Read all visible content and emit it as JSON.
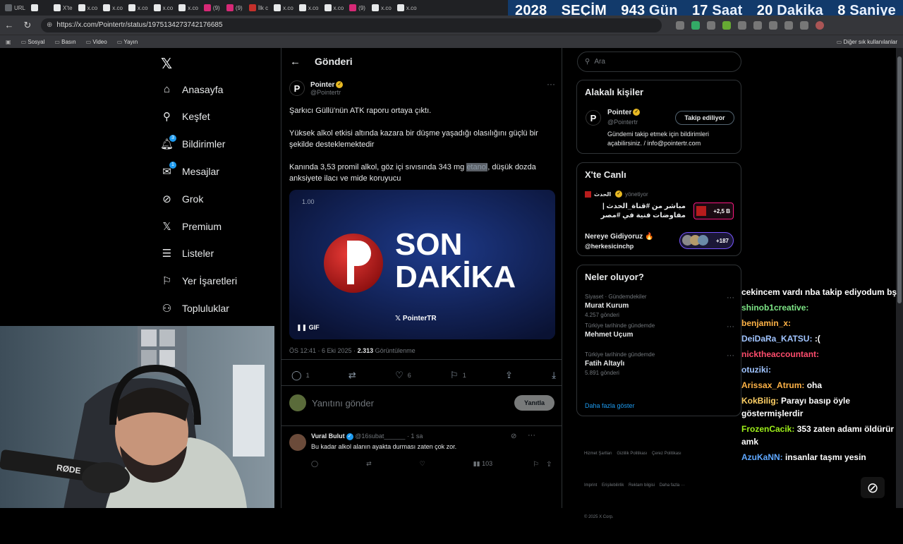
{
  "browser": {
    "tabs": [
      {
        "label": "URL",
        "color": "#5f6368"
      },
      {
        "label": "",
        "color": "#e7e9ea"
      },
      {
        "label": "X'te",
        "color": "#e7e9ea"
      },
      {
        "label": "x.co",
        "color": "#e7e9ea"
      },
      {
        "label": "x.co",
        "color": "#e7e9ea"
      },
      {
        "label": "x.co",
        "color": "#e7e9ea"
      },
      {
        "label": "x.co",
        "color": "#e7e9ea"
      },
      {
        "label": "x.co",
        "color": "#e7e9ea"
      },
      {
        "label": "(9)",
        "color": "#d62976"
      },
      {
        "label": "(9)",
        "color": "#d62976"
      },
      {
        "label": "İlk c",
        "color": "#c4302b"
      },
      {
        "label": "x.co",
        "color": "#e7e9ea"
      },
      {
        "label": "x.co",
        "color": "#e7e9ea"
      },
      {
        "label": "x.co",
        "color": "#e7e9ea"
      },
      {
        "label": "(9)",
        "color": "#d62976"
      },
      {
        "label": "x.co",
        "color": "#e7e9ea"
      },
      {
        "label": "x.co",
        "color": "#e7e9ea"
      }
    ],
    "url": "https://x.com/Pointertr/status/1975134273742176685",
    "bookmarks": [
      "Sosyal",
      "Basın",
      "Video",
      "Yayın"
    ],
    "bookmarks_other": "Diğer sık kullanılanlar"
  },
  "countdown": {
    "year": "2028",
    "label": "SEÇİM",
    "days": "943",
    "days_unit": "Gün",
    "hours": "17",
    "hours_unit": "Saat",
    "minutes": "20",
    "minutes_unit": "Dakika",
    "seconds": "8",
    "seconds_unit": "Saniye"
  },
  "nav": {
    "items": [
      {
        "label": "Anasayfa",
        "icon": "home-icon"
      },
      {
        "label": "Keşfet",
        "icon": "search-icon"
      },
      {
        "label": "Bildirimler",
        "icon": "bell-icon",
        "badge": "3"
      },
      {
        "label": "Mesajlar",
        "icon": "mail-icon",
        "badge": "1"
      },
      {
        "label": "Grok",
        "icon": "grok-icon"
      },
      {
        "label": "Premium",
        "icon": "x-icon"
      },
      {
        "label": "Listeler",
        "icon": "list-icon"
      },
      {
        "label": "Yer İşaretleri",
        "icon": "bookmark-icon"
      },
      {
        "label": "Topluluklar",
        "icon": "people-icon"
      }
    ]
  },
  "post": {
    "header_title": "Gönderi",
    "author_name": "Pointer",
    "author_handle": "@Pointertr",
    "text1": "Şarkıcı Güllü'nün  ATK raporu ortaya çıktı.",
    "text2": " Yüksek alkol etkisi altında kazara bir düşme yaşadığı olasılığını güçlü bir şekilde desteklemektedir",
    "text3_a": "Kanında 3,53 promil alkol, göz içi sıvısında 343 mg ",
    "text3_hl": "etanol",
    "text3_b": ", düşük dozda anksiyete ilacı ve mide koruyucu",
    "media_time": "1.00",
    "media_title1": "SON",
    "media_title2": "DAKİKA",
    "media_brand": "PointerTR",
    "media_gif": "GIF",
    "timestamp": "ÖS 12:41 · 6 Eki 2025 · ",
    "views": "2.313",
    "views_label": " Görüntülenme",
    "replies": "1",
    "likes": "6",
    "bookmarks": "1",
    "reply_placeholder": "Yanıtını gönder",
    "reply_button": "Yanıtla"
  },
  "reply": {
    "name": "Vural Bulut",
    "handle": "@16subat______ · 1 sa",
    "text": "Bu kadar alkol alanın ayakta durması zaten çok zor.",
    "views": "103"
  },
  "right": {
    "search_placeholder": "Ara",
    "related_title": "Alakalı kişiler",
    "related_name": "Pointer",
    "related_handle": "@Pointertr",
    "related_bio": "Gündemi takip etmek için bildirimleri açabilirsiniz. / info@pointertr.com",
    "follow_label": "Takip ediliyor",
    "live_title": "X'te Canlı",
    "live1_host": "الحدث",
    "live1_role": "yönetiyor",
    "live1_text": "مباشر من #قناة_الحدث | مفاوضات فنية في #مصر تحسم تنفيذ اتفاق ...",
    "live1_count": "+2,5 B",
    "live2_text": "Nereye Gidiyoruz 🔥",
    "live2_handle": "@herkesicinchp",
    "live2_count": "+187",
    "trends_title": "Neler oluyor?",
    "trends": [
      {
        "ctx": "Siyaset · Gündemdekiler",
        "name": "Murat Kurum",
        "count": "4.257 gönderi"
      },
      {
        "ctx": "Türkiye tarihinde gündemde",
        "name": "Mehmet Uçum",
        "count": ""
      },
      {
        "ctx": "Türkiye tarihinde gündemde",
        "name": "Fatih Altaylı",
        "count": "5.891 gönderi"
      }
    ],
    "show_more": "Daha fazla göster",
    "footer1": "Hizmet Şartları    Gizlilik Politikası    Çerez Politikası",
    "footer2": "Imprint    Erişilebilirlik    Reklam bilgisi    Daha fazla ···",
    "footer3": "© 2025 X Corp."
  },
  "chat": {
    "lines": [
      {
        "user": "",
        "text": "cekincem vardı nba takip ediyodum bş",
        "color": "#ffffff"
      },
      {
        "user": "shinob1creative:",
        "text": "",
        "color": "#7ee787"
      },
      {
        "user": "benjamin_x:",
        "text": "",
        "color": "#ffb347"
      },
      {
        "user": "DeiDaRa_KATSU:",
        "text": ":(",
        "color": "#a0c4ff"
      },
      {
        "user": "nicktheaccountant:",
        "text": "",
        "color": "#ff4d6d"
      },
      {
        "user": "otuziki:",
        "text": "",
        "color": "#a0c4ff"
      },
      {
        "user": "Arissax_Atrum:",
        "text": "oha",
        "color": "#ffb347"
      },
      {
        "user": "KokBilig:",
        "text": "Parayı basıp öyle göstermişlerdir",
        "color": "#ffd166"
      },
      {
        "user": "FrozenCacik:",
        "text": "353 zaten adamı öldürür amk",
        "color": "#9ef01a"
      },
      {
        "user": "AzuKaNN:",
        "text": "insanlar taşmı yesin",
        "color": "#5fa8ff"
      }
    ]
  },
  "webcam": {
    "mic_brand": "RØDE"
  }
}
